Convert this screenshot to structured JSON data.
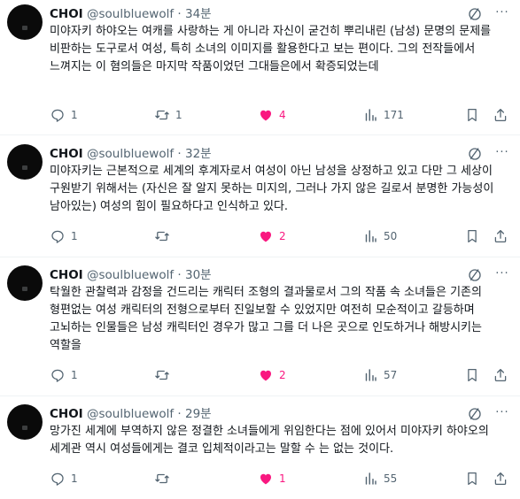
{
  "tweets": [
    {
      "name": "CHOI",
      "handle": "@soulbluewolf",
      "sep": "·",
      "time": "34분",
      "text": "미야자키 하야오는 여캐를 사랑하는 게 아니라 자신이 굳건히 뿌리내린 (남성) 문명의 문제를 비판하는 도구로서 여성, 특히 소녀의 이미지를 활용한다고 보는 편이다. 그의 전작들에서 느껴지는 이 혐의들은 마지막 작품이었던 그대들은에서 확증되었는데",
      "replies": "1",
      "reposts": "1",
      "likes": "4",
      "views": "171"
    },
    {
      "name": "CHOI",
      "handle": "@soulbluewolf",
      "sep": "·",
      "time": "32분",
      "text": "미야자키는 근본적으로 세계의 후계자로서 여성이 아닌 남성을 상정하고 있고 다만 그 세상이 구원받기 위해서는 (자신은 잘 알지 못하는 미지의, 그러나 가지 않은 길로서 분명한 가능성이 남아있는) 여성의 힘이 필요하다고 인식하고 있다.",
      "replies": "1",
      "reposts": "",
      "likes": "2",
      "views": "50"
    },
    {
      "name": "CHOI",
      "handle": "@soulbluewolf",
      "sep": "·",
      "time": "30분",
      "text": "탁월한 관찰력과 감정을 건드리는 캐릭터 조형의 결과물로서 그의 작품 속 소녀들은 기존의 형편없는 여성 캐릭터의 전형으로부터 진일보할 수 있었지만 여전히 모순적이고 갈등하며 고뇌하는 인물들은 남성 캐릭터인 경우가 많고 그를 더 나은 곳으로 인도하거나 해방시키는 역할을",
      "replies": "1",
      "reposts": "",
      "likes": "2",
      "views": "57"
    },
    {
      "name": "CHOI",
      "handle": "@soulbluewolf",
      "sep": "·",
      "time": "29분",
      "text": "망가진 세계에 부역하지 않은 정결한 소녀들에게 위임한다는 점에 있어서 미야자키 하야오의 세계관 역시 여성들에게는 결코 입체적이라고는 말할 수 는 없는 것이다.",
      "replies": "1",
      "reposts": "",
      "likes": "1",
      "views": "55"
    }
  ],
  "icons": {
    "avatar": "avatar",
    "grok": "grok-icon",
    "more": "more-icon",
    "reply": "reply-icon",
    "repost": "repost-icon",
    "like": "heart-filled-icon",
    "views": "views-icon",
    "bookmark": "bookmark-icon",
    "share": "share-icon"
  },
  "colors": {
    "text": "#0f1419",
    "secondary": "#536471",
    "like": "#f91880",
    "divider": "#eff3f4"
  },
  "more_label": "···"
}
